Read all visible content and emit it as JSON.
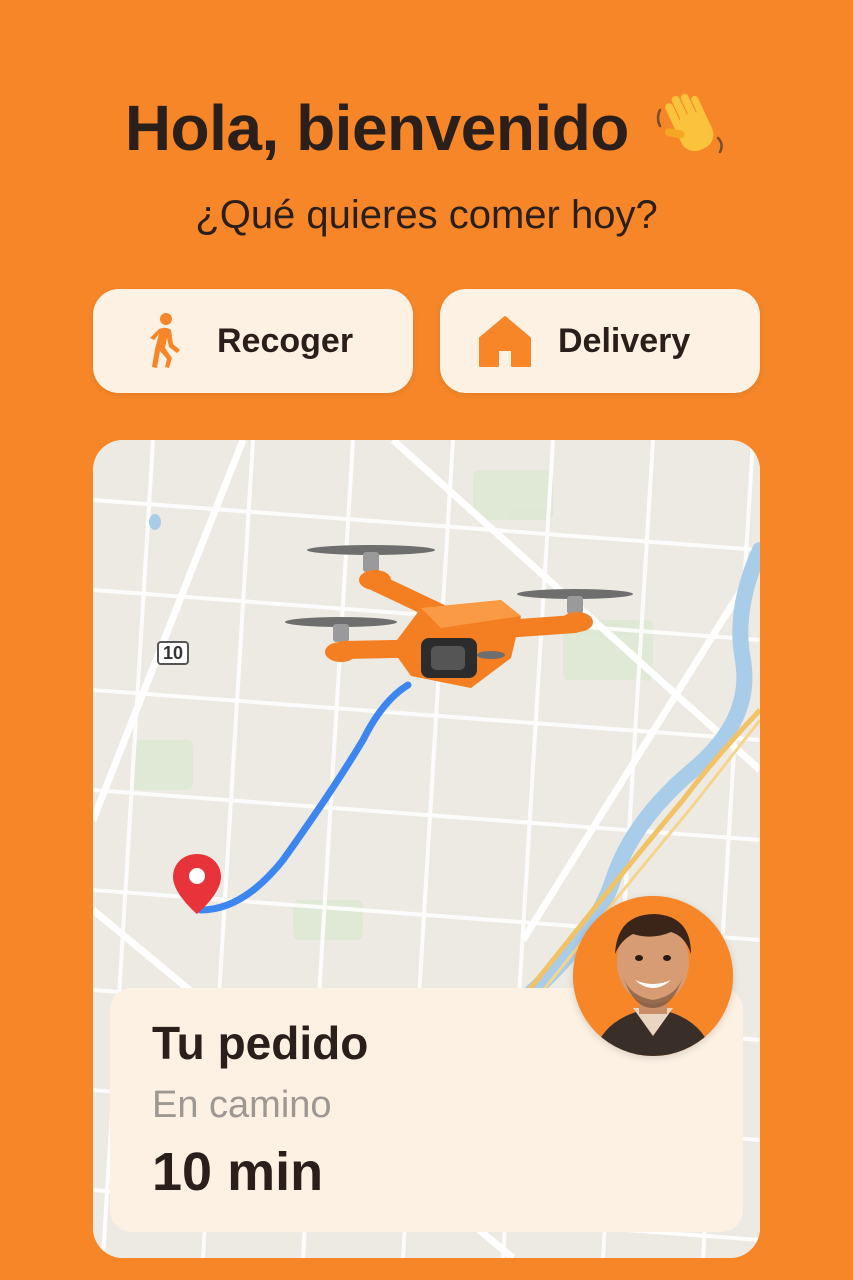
{
  "header": {
    "greeting": "Hola, bienvenido",
    "greeting_icon": "waving-hand-icon",
    "subtitle": "¿Qué quieres comer hoy?"
  },
  "modes": [
    {
      "label": "Recoger",
      "icon": "walking-person-icon"
    },
    {
      "label": "Delivery",
      "icon": "house-icon"
    }
  ],
  "map": {
    "road_shield": "10",
    "destination_icon": "map-pin-icon",
    "vehicle_icon": "drone-icon",
    "route_color": "#3D86F0"
  },
  "order": {
    "title": "Tu pedido",
    "status": "En camino",
    "eta": "10 min"
  },
  "colors": {
    "background": "#F68628",
    "card": "#FDF1E3",
    "text": "#2A1F1A",
    "muted": "#9E9893",
    "pin": "#E8333B"
  }
}
